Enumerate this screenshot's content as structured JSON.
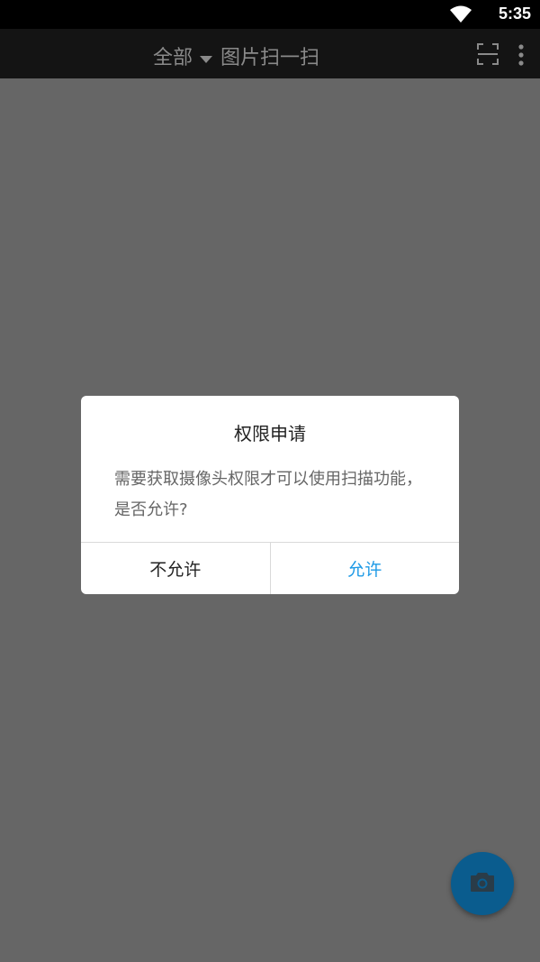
{
  "status_bar": {
    "time": "5:35",
    "wifi_icon": "wifi-icon"
  },
  "app_bar": {
    "filter_label": "全部",
    "title": "图片扫一扫",
    "icons": [
      "caret-down-icon",
      "scan-frame-icon",
      "more-vert-icon"
    ]
  },
  "dialog": {
    "title": "权限申请",
    "message": "需要获取摄像头权限才可以使用扫描功能， 是否允许?",
    "deny_label": "不允许",
    "allow_label": "允许",
    "allow_color": "#1e9ae6"
  },
  "fab": {
    "icon": "camera-icon",
    "color": "#0a5c8e"
  },
  "colors": {
    "overlay_bg": "#666666",
    "app_bar_bg": "#141414",
    "status_bar_bg": "#000000"
  }
}
